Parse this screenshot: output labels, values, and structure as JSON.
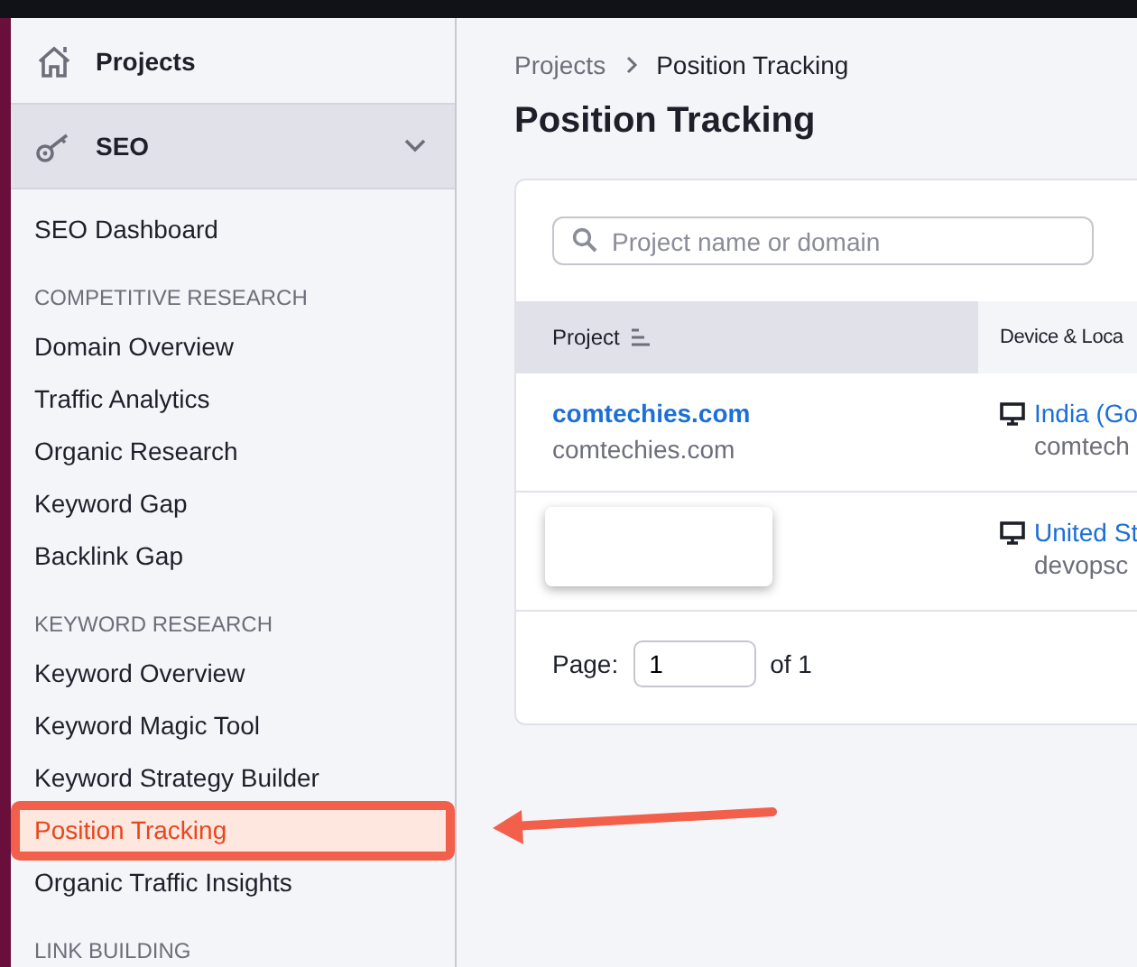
{
  "sidebar": {
    "projects_label": "Projects",
    "seo_label": "SEO",
    "seo_expanded": true,
    "sections": [
      {
        "items": [
          {
            "label": "SEO Dashboard",
            "selected": false
          }
        ]
      },
      {
        "heading": "COMPETITIVE RESEARCH",
        "items": [
          {
            "label": "Domain Overview",
            "selected": false
          },
          {
            "label": "Traffic Analytics",
            "selected": false
          },
          {
            "label": "Organic Research",
            "selected": false
          },
          {
            "label": "Keyword Gap",
            "selected": false
          },
          {
            "label": "Backlink Gap",
            "selected": false
          }
        ]
      },
      {
        "heading": "KEYWORD RESEARCH",
        "items": [
          {
            "label": "Keyword Overview",
            "selected": false
          },
          {
            "label": "Keyword Magic Tool",
            "selected": false
          },
          {
            "label": "Keyword Strategy Builder",
            "selected": false
          },
          {
            "label": "Position Tracking",
            "selected": true
          },
          {
            "label": "Organic Traffic Insights",
            "selected": false
          }
        ]
      },
      {
        "heading": "LINK BUILDING"
      }
    ]
  },
  "breadcrumb": [
    "Projects",
    "Position Tracking"
  ],
  "title": "Position Tracking",
  "search": {
    "placeholder": "Project name or domain"
  },
  "table": {
    "columns": [
      "Project",
      "Device & Loca"
    ],
    "rows": [
      {
        "project_name": "comtechies.com",
        "project_domain": "comtechies.com",
        "redacted": false,
        "location": "India (Go",
        "location_domain": "comtech"
      },
      {
        "redacted": true,
        "location": "United St",
        "location_domain": "devopsc"
      }
    ]
  },
  "pager": {
    "label": "Page:",
    "value": "1",
    "total": "of 1"
  }
}
